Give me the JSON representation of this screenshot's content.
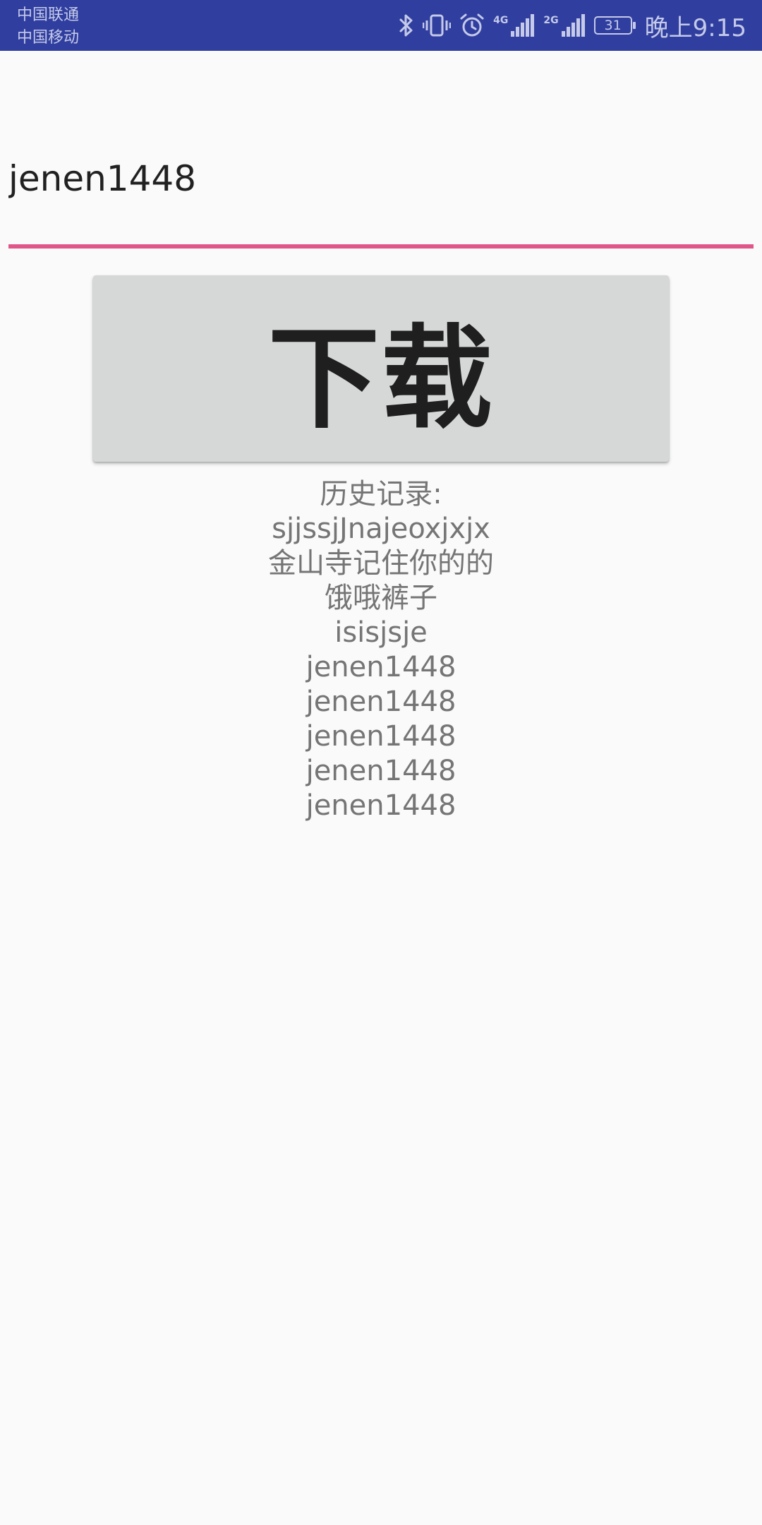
{
  "status_bar": {
    "carrier_1": "中国联通",
    "carrier_2": "中国移动",
    "network_1": "4G",
    "network_2": "2G",
    "battery_level": "31",
    "time": "晚上9:15",
    "icons": [
      "bluetooth-icon",
      "vibrate-icon",
      "alarm-icon",
      "signal-icon",
      "signal-icon",
      "battery-icon"
    ],
    "colors": {
      "background": "#303f9f",
      "foreground": "#c5cae9"
    }
  },
  "input": {
    "value": "jenen1448",
    "underline_color": "#e05689"
  },
  "download_button": {
    "label": "下载",
    "background": "#d6d7d7"
  },
  "history": {
    "heading": "历史记录:",
    "entries": [
      "sjjssjJnajeoxjxjx",
      "金山寺记住你的的",
      "饿哦裤子",
      "isisjsje",
      "jenen1448",
      "jenen1448",
      "jenen1448",
      "jenen1448",
      "jenen1448"
    ]
  }
}
